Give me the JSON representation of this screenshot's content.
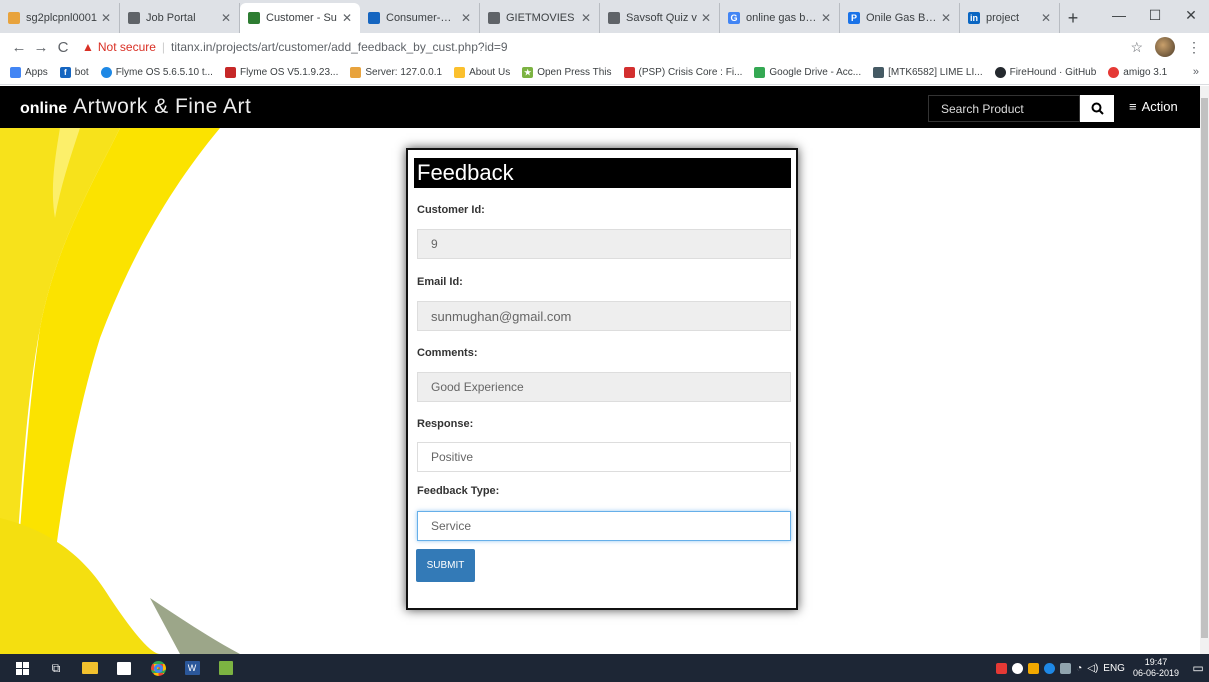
{
  "browser": {
    "tabs": [
      {
        "label": "sg2plcpnl0001",
        "color": "#e8a33d",
        "active": false
      },
      {
        "label": "Job Portal",
        "color": "#5f6368",
        "active": false
      },
      {
        "label": "Customer - Su",
        "color": "#2e7d32",
        "active": true
      },
      {
        "label": "Consumer-Das",
        "color": "#1565c0",
        "active": false
      },
      {
        "label": "GIETMOVIES",
        "color": "#5f6368",
        "active": false
      },
      {
        "label": "Savsoft Quiz v",
        "color": "#5f6368",
        "active": false
      },
      {
        "label": "online gas boo",
        "color": "#4285f4",
        "active": false
      },
      {
        "label": "Onile Gas Book",
        "color": "#1a73e8",
        "active": false
      },
      {
        "label": "project",
        "color": "#0a66c2",
        "active": false
      }
    ],
    "new_tab": "+",
    "window_controls": {
      "minimize": "—",
      "maximize": "☐",
      "close": "✕"
    },
    "not_secure_label": "Not secure",
    "url": "titanx.in/projects/art/customer/add_feedback_by_cust.php?id=9",
    "bookmarks": [
      {
        "label": "Apps",
        "color": "#4285f4"
      },
      {
        "label": "bot",
        "color": "#1565c0"
      },
      {
        "label": "Flyme OS 5.6.5.10 t...",
        "color": "#1e88e5"
      },
      {
        "label": "Flyme OS V5.1.9.23...",
        "color": "#c62828"
      },
      {
        "label": "Server: 127.0.0.1",
        "color": "#e8a33d"
      },
      {
        "label": "About Us",
        "color": "#fbc02d"
      },
      {
        "label": "Open Press This",
        "color": "#7cb342"
      },
      {
        "label": "(PSP) Crisis Core : Fi...",
        "color": "#d32f2f"
      },
      {
        "label": "Google Drive - Acc...",
        "color": "#34a853"
      },
      {
        "label": "[MTK6582] LIME LI...",
        "color": "#455a64"
      },
      {
        "label": "FireHound · GitHub",
        "color": "#24292e"
      },
      {
        "label": "amigo 3.1",
        "color": "#e53935"
      }
    ],
    "bookmarks_more": "»"
  },
  "site": {
    "brand_small": "online",
    "brand_large": "Artwork & Fine Art",
    "search_placeholder": "Search Product",
    "action_label": "Action"
  },
  "form": {
    "title": "Feedback",
    "fields": [
      {
        "label": "Customer Id:",
        "value": "9"
      },
      {
        "label": "Email Id:",
        "value": "sunmughan@gmail.com"
      },
      {
        "label": "Comments:",
        "value": "Good Experience"
      },
      {
        "label": "Response:",
        "value": "Positive"
      },
      {
        "label": "Feedback Type:",
        "value": "Service"
      }
    ],
    "submit_label": "SUBMIT"
  },
  "taskbar": {
    "lang": "ENG",
    "time": "19:47",
    "date": "06-06-2019"
  }
}
